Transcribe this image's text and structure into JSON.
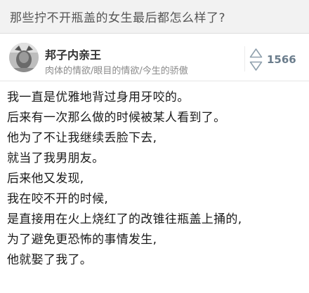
{
  "question": {
    "title": "那些拧不开瓶盖的女生最后都怎么样了?"
  },
  "author": {
    "name": "邦子内亲王",
    "bio": "肉体的情欲/眼目的情欲/今生的骄傲",
    "avatar_icon": "avatar-image"
  },
  "vote": {
    "count": "1566",
    "up_icon": "upvote-arrow-icon",
    "down_icon": "downvote-arrow-icon",
    "color": "#6b7d8c"
  },
  "answer": {
    "lines": [
      "我一直是优雅地背过身用牙咬的。",
      "后来有一次那么做的时候被某人看到了。",
      "他为了不让我继续丢脸下去,",
      "就当了我男朋友。",
      "后来他又发现,",
      "我在咬不开的时候,",
      "是直接用在火上烧红了的改锥往瓶盖上捅的,",
      "为了避免更恐怖的事情发生,",
      "他就娶了我了。"
    ]
  }
}
